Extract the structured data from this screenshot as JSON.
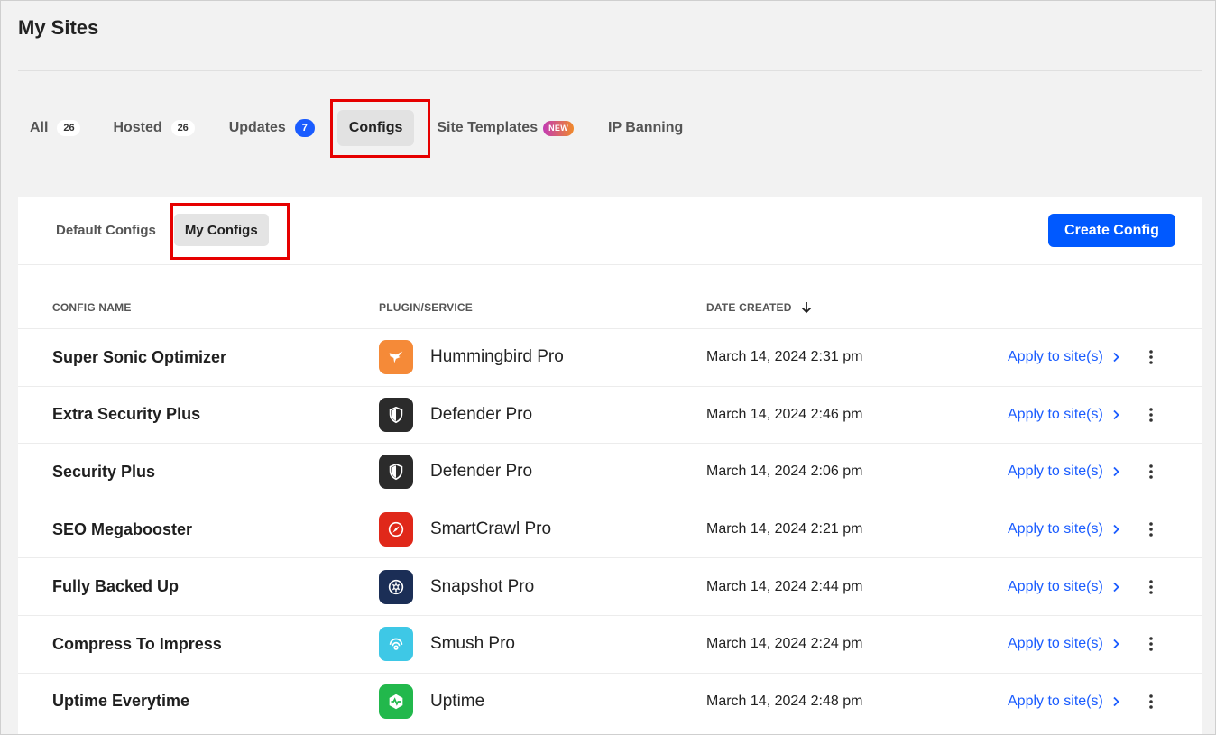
{
  "page": {
    "title": "My Sites"
  },
  "tabs": [
    {
      "label": "All",
      "count": "26"
    },
    {
      "label": "Hosted",
      "count": "26"
    },
    {
      "label": "Updates",
      "count": "7"
    },
    {
      "label": "Configs"
    },
    {
      "label": "Site Templates",
      "badge": "NEW"
    },
    {
      "label": "IP Banning"
    }
  ],
  "subtabs": [
    {
      "label": "Default Configs"
    },
    {
      "label": "My Configs"
    }
  ],
  "create_button": "Create Config",
  "table": {
    "headers": {
      "name": "CONFIG NAME",
      "plugin": "PLUGIN/SERVICE",
      "date": "DATE CREATED"
    },
    "apply_label": "Apply to site(s)",
    "rows": [
      {
        "name": "Super Sonic Optimizer",
        "plugin": "Hummingbird Pro",
        "icon": "hummingbird-icon",
        "color": "#f58a38",
        "date": "March 14, 2024 2:31 pm"
      },
      {
        "name": "Extra Security Plus",
        "plugin": "Defender Pro",
        "icon": "shield-icon",
        "color": "#2b2b2b",
        "date": "March 14, 2024 2:46 pm"
      },
      {
        "name": "Security Plus",
        "plugin": "Defender Pro",
        "icon": "shield-icon",
        "color": "#2b2b2b",
        "date": "March 14, 2024 2:06 pm"
      },
      {
        "name": "SEO Megabooster",
        "plugin": "SmartCrawl Pro",
        "icon": "compass-icon",
        "color": "#e0281a",
        "date": "March 14, 2024 2:21 pm"
      },
      {
        "name": "Fully Backed Up",
        "plugin": "Snapshot Pro",
        "icon": "aperture-icon",
        "color": "#1b2e56",
        "date": "March 14, 2024 2:44 pm"
      },
      {
        "name": "Compress To Impress",
        "plugin": "Smush Pro",
        "icon": "signal-icon",
        "color": "#3ec8e6",
        "date": "March 14, 2024 2:24 pm"
      },
      {
        "name": "Uptime Everytime",
        "plugin": "Uptime",
        "icon": "heartbeat-icon",
        "color": "#22b84c",
        "date": "March 14, 2024 2:48 pm"
      }
    ]
  },
  "colors": {
    "accent": "#0059ff",
    "highlight": "#e60000"
  }
}
